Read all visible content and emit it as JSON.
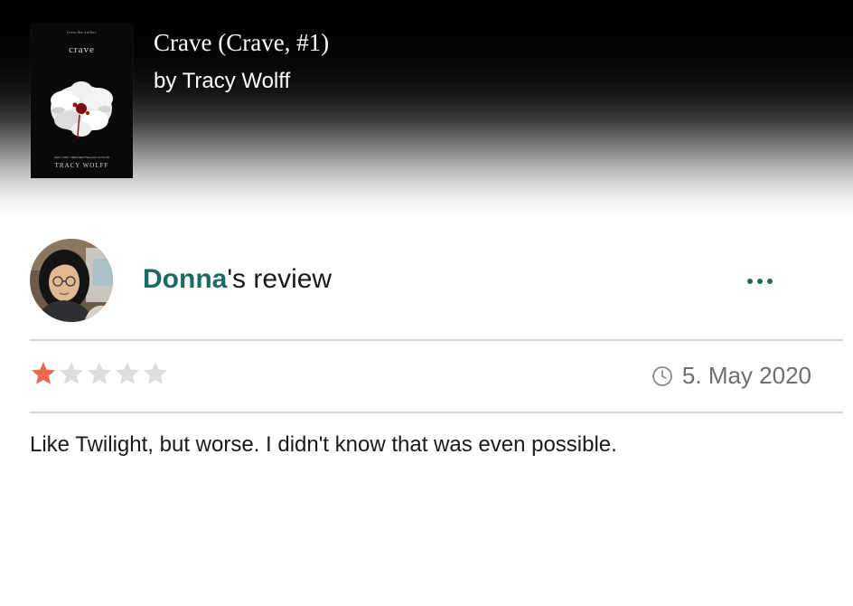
{
  "book": {
    "title": "Crave (Crave, #1)",
    "author_line": "by Tracy Wolff",
    "cover": {
      "tagline": "from the author",
      "title": "crave",
      "author_note": "NEW YORK TIMES BESTSELLING AUTHOR",
      "author": "TRACY WOLFF"
    }
  },
  "review": {
    "reviewer_name": "Donna",
    "heading_suffix": "'s review",
    "more_icon": "more-horizontal-icon",
    "rating": 1,
    "rating_max": 5,
    "date": "5. May 2020",
    "date_icon": "clock-icon",
    "body": "Like Twilight, but worse. I didn't know that was even possible."
  },
  "colors": {
    "accent": "#1c6b63",
    "star_filled": "#e96a4f",
    "star_empty": "#dddddd",
    "muted_text": "#6f6f6f",
    "divider": "#d6d6d6"
  }
}
